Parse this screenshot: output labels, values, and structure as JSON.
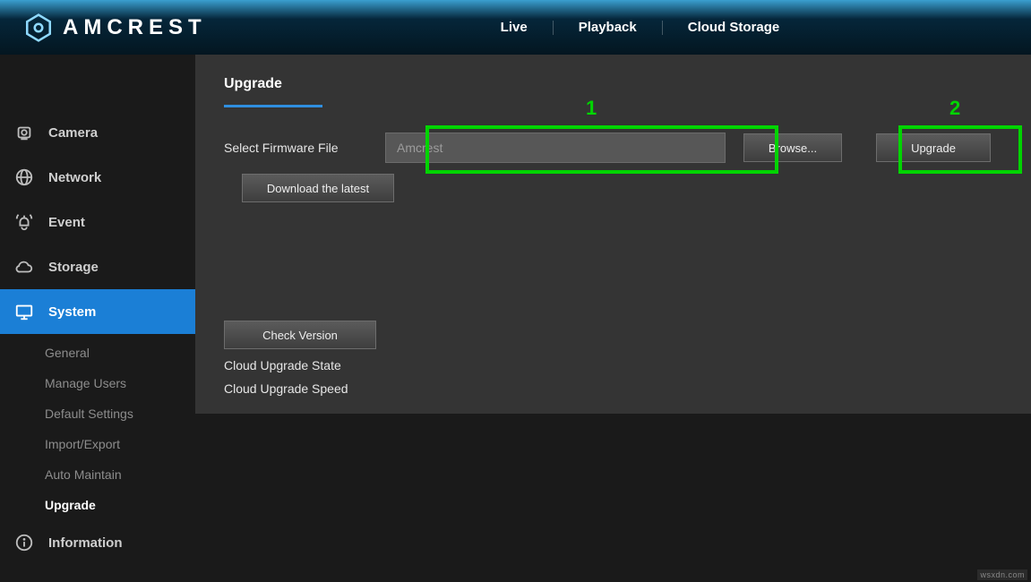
{
  "brand": {
    "name": "AMCREST"
  },
  "topnav": {
    "live": "Live",
    "playback": "Playback",
    "cloud": "Cloud Storage"
  },
  "sidebar": {
    "items": [
      {
        "label": "Camera"
      },
      {
        "label": "Network"
      },
      {
        "label": "Event"
      },
      {
        "label": "Storage"
      },
      {
        "label": "System"
      },
      {
        "label": "Information"
      }
    ],
    "systemSub": {
      "general": "General",
      "manageUsers": "Manage Users",
      "defaultSettings": "Default Settings",
      "importExport": "Import/Export",
      "autoMaintain": "Auto Maintain",
      "upgrade": "Upgrade"
    }
  },
  "page": {
    "title": "Upgrade",
    "selectFirmwareLabel": "Select Firmware File",
    "firmwareFieldValue": "Amcrest",
    "browseBtn": "Browse...",
    "upgradeBtn": "Upgrade",
    "downloadLatestBtn": "Download the latest",
    "checkVersionBtn": "Check Version",
    "cloudUpgradeState": "Cloud Upgrade State",
    "cloudUpgradeSpeed": "Cloud Upgrade Speed"
  },
  "annotations": {
    "one": "1",
    "two": "2"
  },
  "watermark": "wsxdn.com"
}
